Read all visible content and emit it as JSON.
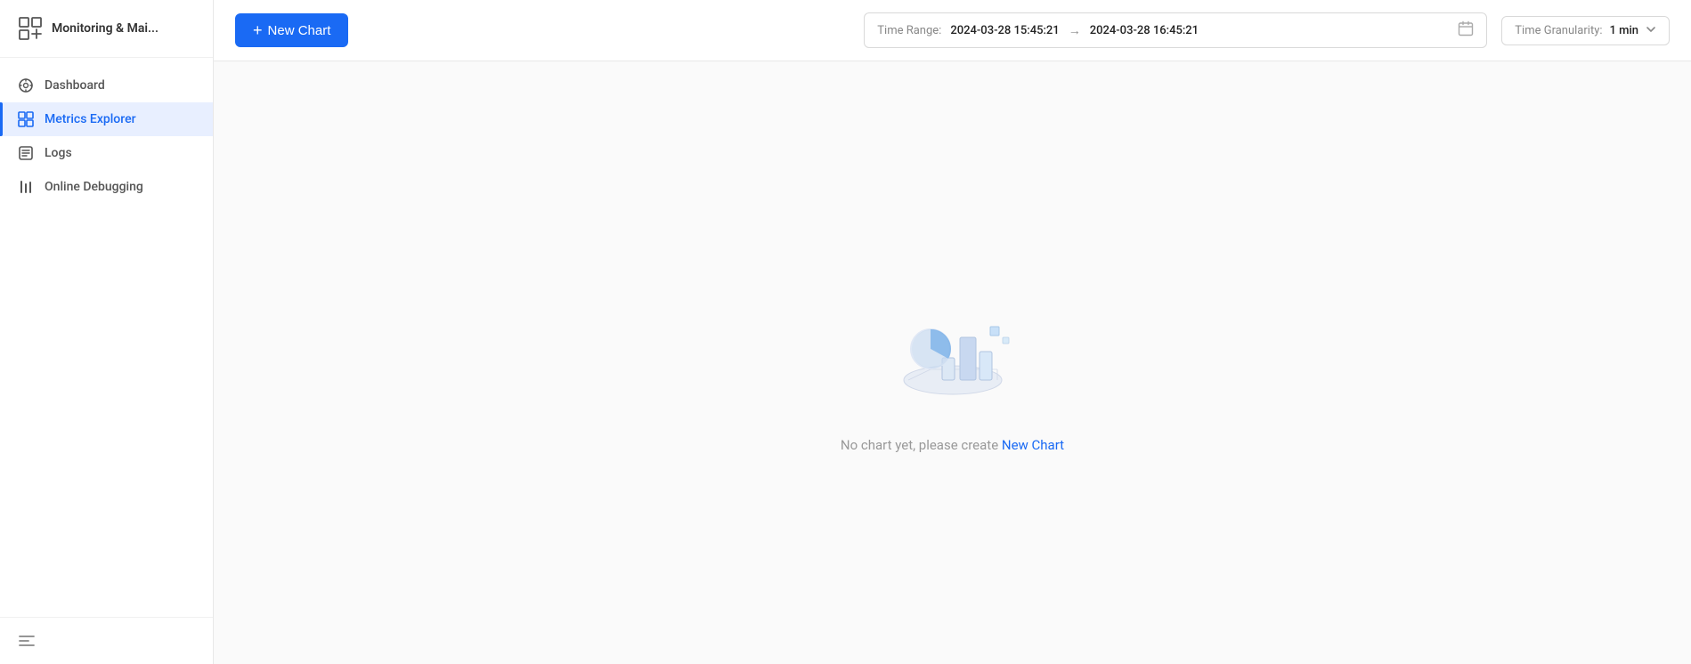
{
  "sidebar": {
    "logo": {
      "title": "Monitoring & Mai..."
    },
    "items": [
      {
        "id": "dashboard",
        "label": "Dashboard",
        "active": false
      },
      {
        "id": "metrics-explorer",
        "label": "Metrics Explorer",
        "active": true
      },
      {
        "id": "logs",
        "label": "Logs",
        "active": false
      },
      {
        "id": "online-debugging",
        "label": "Online Debugging",
        "active": false
      }
    ]
  },
  "topbar": {
    "new_chart_label": "New Chart",
    "time_range": {
      "label": "Time Range:",
      "start": "2024-03-28 15:45:21",
      "end": "2024-03-28 16:45:21"
    },
    "granularity": {
      "label": "Time Granularity:",
      "value": "1 min"
    }
  },
  "empty_state": {
    "message": "No chart yet, please create ",
    "link_text": "New Chart"
  },
  "icons": {
    "monitoring": "▣",
    "dashboard": "◎",
    "metrics_explorer": "⊞",
    "logs": "☰",
    "debugging": "|||",
    "plus": "+",
    "calendar": "📅",
    "chevron_down": "∨",
    "arrow_right": "→",
    "menu_bottom": "≡"
  },
  "colors": {
    "primary": "#1a6af4",
    "active_bg": "#e8efff",
    "active_text": "#1a6af4",
    "sidebar_border": "#e8e8e8",
    "text_primary": "#333",
    "text_secondary": "#888",
    "text_muted": "#999"
  }
}
